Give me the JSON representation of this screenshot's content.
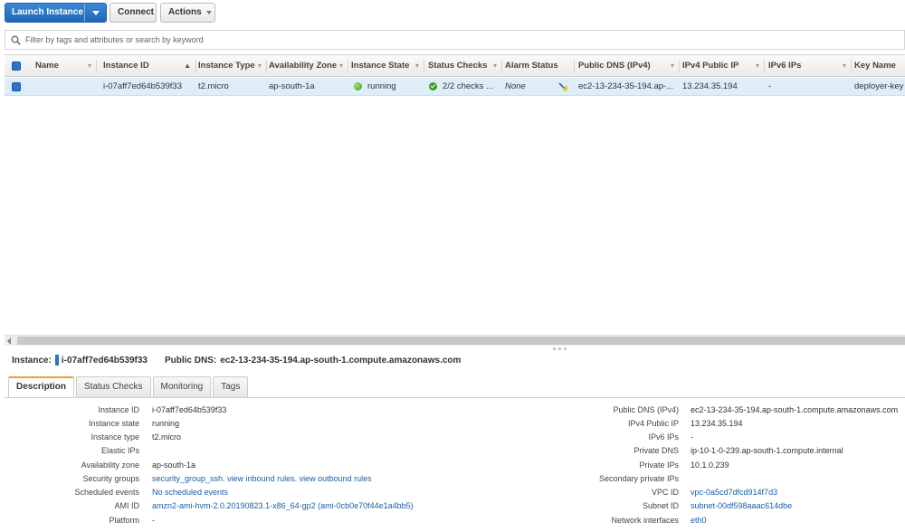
{
  "toolbar": {
    "launch_label": "Launch Instance",
    "connect_label": "Connect",
    "actions_label": "Actions"
  },
  "filter": {
    "placeholder": "Filter by tags and attributes or search by keyword"
  },
  "grid": {
    "columns": {
      "name": "Name",
      "instance_id": "Instance ID",
      "instance_type": "Instance Type",
      "availability_zone": "Availability Zone",
      "instance_state": "Instance State",
      "status_checks": "Status Checks",
      "alarm_status": "Alarm Status",
      "public_dns": "Public DNS (IPv4)",
      "ipv4_public_ip": "IPv4 Public IP",
      "ipv6_ips": "IPv6 IPs",
      "key_name": "Key Name"
    },
    "sorted_column_indicator": "▲",
    "rows": [
      {
        "name": "",
        "instance_id": "i-07aff7ed64b539f33",
        "instance_type": "t2.micro",
        "availability_zone": "ap-south-1a",
        "instance_state": "running",
        "status_checks": "2/2 checks ...",
        "alarm_status": "None",
        "public_dns": "ec2-13-234-35-194.ap-...",
        "ipv4_public_ip": "13.234.35.194",
        "ipv6_ips": "-",
        "key_name": "deployer-key"
      }
    ]
  },
  "detail": {
    "instance_label": "Instance:",
    "instance_id": "i-07aff7ed64b539f33",
    "public_dns_label": "Public DNS:",
    "public_dns": "ec2-13-234-35-194.ap-south-1.compute.amazonaws.com",
    "tabs": [
      "Description",
      "Status Checks",
      "Monitoring",
      "Tags"
    ],
    "active_tab": "Description",
    "left": [
      {
        "key": "Instance ID",
        "value": "i-07aff7ed64b539f33"
      },
      {
        "key": "Instance state",
        "value": "running"
      },
      {
        "key": "Instance type",
        "value": "t2.micro"
      },
      {
        "key": "Elastic IPs",
        "value": ""
      },
      {
        "key": "Availability zone",
        "value": "ap-south-1a"
      },
      {
        "key": "Security groups",
        "value": "security_group_ssh. view inbound rules. view outbound rules"
      },
      {
        "key": "Scheduled events",
        "value": "No scheduled events"
      },
      {
        "key": "AMI ID",
        "value": "amzn2-ami-hvm-2.0.20190823.1-x86_64-gp2 (ami-0cb0e70f44e1a4bb5)"
      },
      {
        "key": "Platform",
        "value": "-"
      }
    ],
    "right": [
      {
        "key": "Public DNS (IPv4)",
        "value": "ec2-13-234-35-194.ap-south-1.compute.amazonaws.com"
      },
      {
        "key": "IPv4 Public IP",
        "value": "13.234.35.194"
      },
      {
        "key": "IPv6 IPs",
        "value": "-"
      },
      {
        "key": "Private DNS",
        "value": "ip-10-1-0-239.ap-south-1.compute.internal"
      },
      {
        "key": "Private IPs",
        "value": "10.1.0.239"
      },
      {
        "key": "Secondary private IPs",
        "value": ""
      },
      {
        "key": "VPC ID",
        "value": "vpc-0a5cd7dfcd914f7d3"
      },
      {
        "key": "Subnet ID",
        "value": "subnet-00df598aaac614dbe"
      },
      {
        "key": "Network interfaces",
        "value": "eth0"
      }
    ]
  },
  "colors": {
    "accent": "#2065b8",
    "selected_row": "#dfedf9",
    "link": "#1a5fa8",
    "status_green": "#3b9e1a",
    "active_tab_border": "#e8a13b"
  }
}
